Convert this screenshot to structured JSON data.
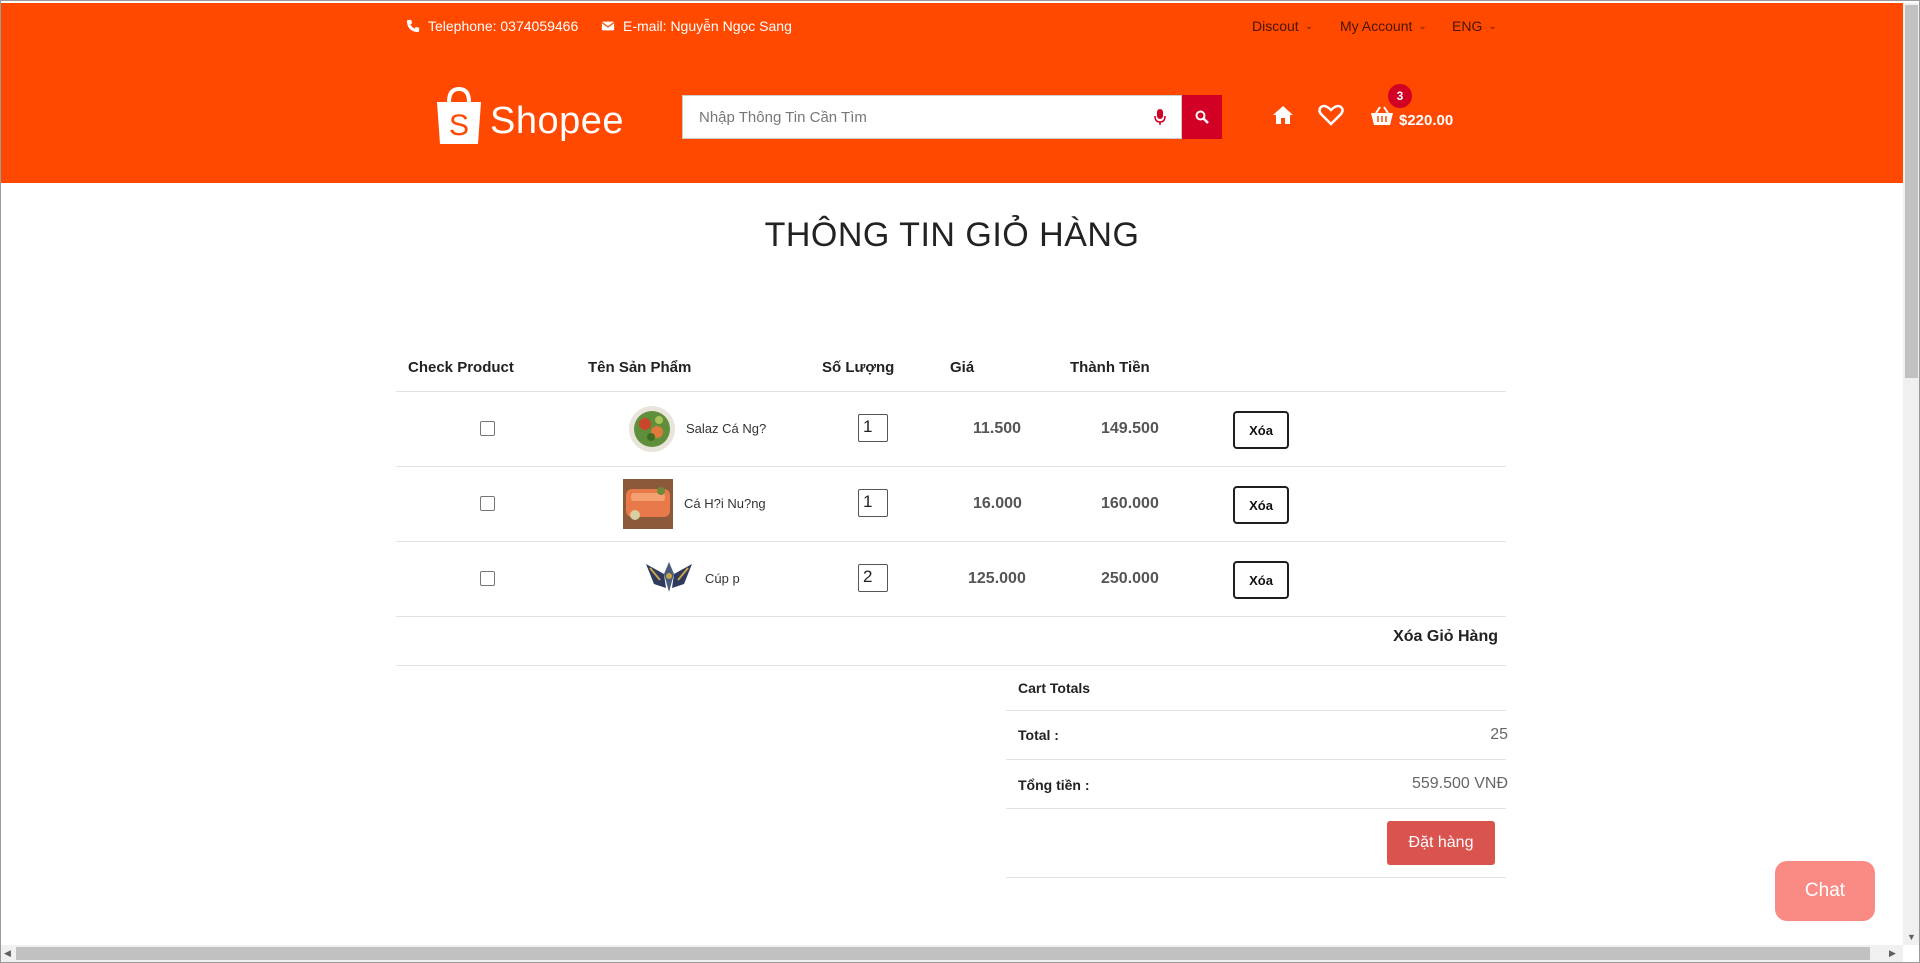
{
  "header": {
    "phone": "Telephone: 0374059466",
    "email": "E-mail: Nguyễn Ngọc Sang",
    "nav": {
      "discount": "Discout",
      "account": "My Account",
      "language": "ENG"
    },
    "logo_text": "Shopee",
    "search_placeholder": "Nhập Thông Tin Cần Tìm",
    "cart_count": "3",
    "cart_total": "$220.00"
  },
  "page": {
    "title": "THÔNG TIN GIỎ HÀNG"
  },
  "table": {
    "headers": {
      "check": "Check Product",
      "name": "Tên Sản Phẩm",
      "qty": "Số Lượng",
      "price": "Giá",
      "subtotal": "Thành Tiền"
    },
    "rows": [
      {
        "name": "Salaz Cá Ng?",
        "qty": "1",
        "price": "11.500",
        "subtotal": "149.500",
        "delete_label": "Xóa"
      },
      {
        "name": "Cá H?i Nu?ng",
        "qty": "1",
        "price": "16.000",
        "subtotal": "160.000",
        "delete_label": "Xóa"
      },
      {
        "name": "Cúp p",
        "qty": "2",
        "price": "125.000",
        "subtotal": "250.000",
        "delete_label": "Xóa"
      }
    ],
    "clear_cart": "Xóa Giỏ Hàng"
  },
  "totals": {
    "heading": "Cart Totals",
    "total_label": "Total :",
    "total_value": "25",
    "sum_label": "Tổng tiền :",
    "sum_value": "559.500 VNĐ",
    "order_button": "Đặt hàng"
  },
  "chat": {
    "label": "Chat"
  },
  "colors": {
    "brand": "#ff4800",
    "accent_red": "#d10024",
    "order_button": "#d9534f",
    "chat_button": "#fa8b84"
  }
}
